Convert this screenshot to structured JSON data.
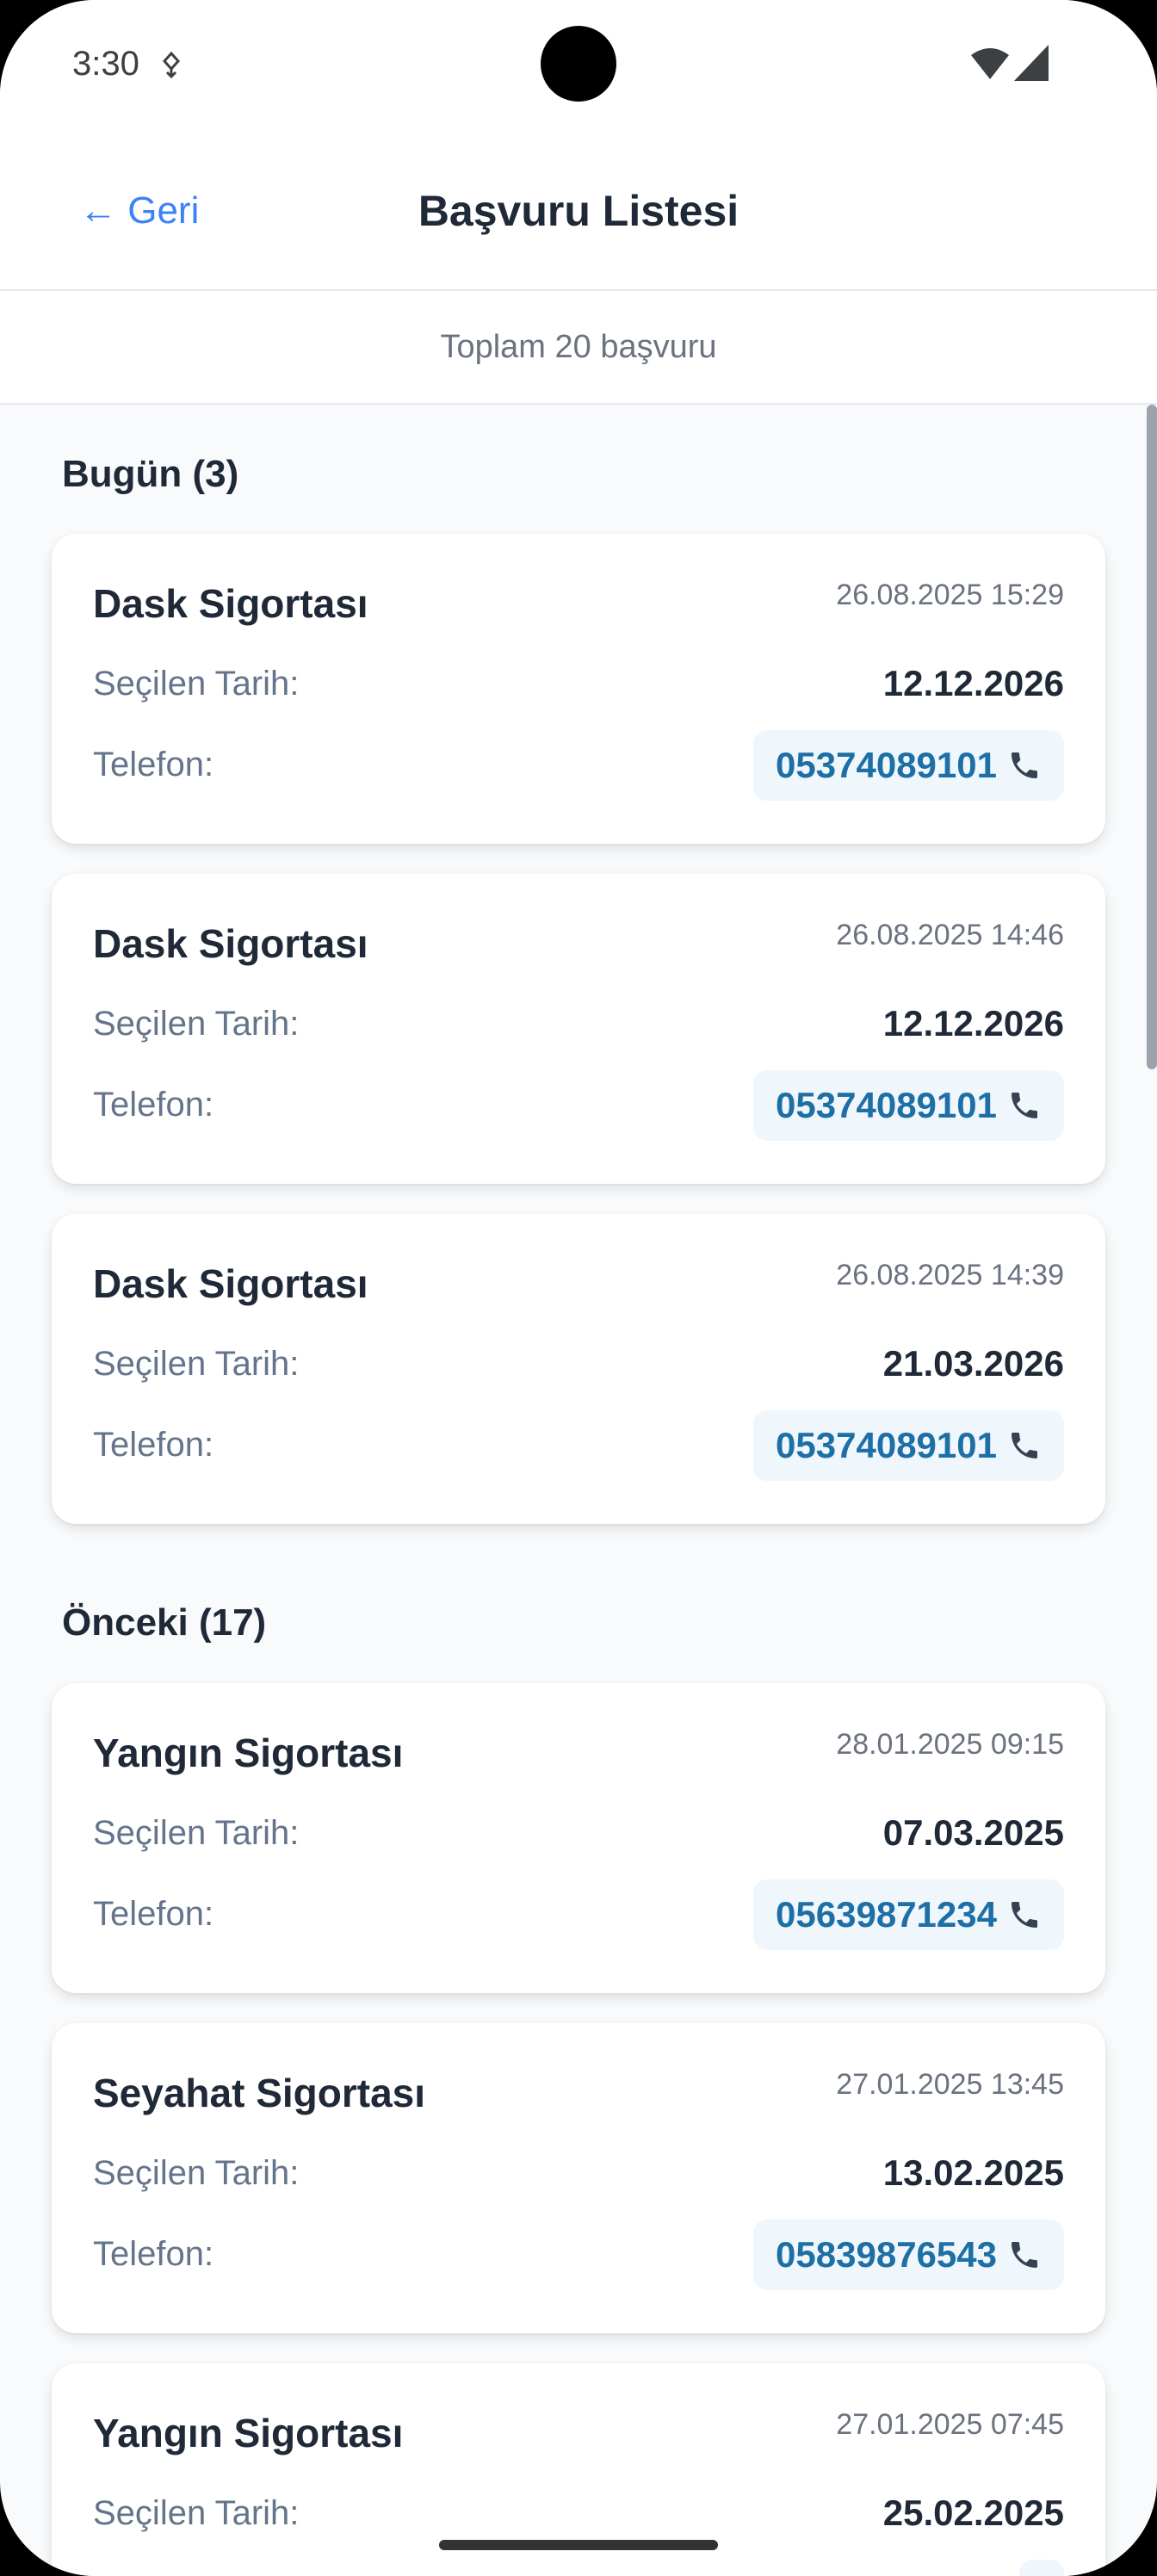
{
  "status_bar": {
    "time": "3:30"
  },
  "header": {
    "back_label": "← Geri",
    "title": "Başvuru Listesi"
  },
  "summary": {
    "text": "Toplam 20 başvuru"
  },
  "sections": [
    {
      "title": "Bugün (3)"
    },
    {
      "title": "Önceki (17)"
    }
  ],
  "labels": {
    "selected_date": "Seçilen Tarih:",
    "phone": "Telefon:"
  },
  "cards": [
    {
      "title": "Dask Sigortası",
      "created": "26.08.2025 15:29",
      "selected_date": "12.12.2026",
      "phone": "05374089101"
    },
    {
      "title": "Dask Sigortası",
      "created": "26.08.2025 14:46",
      "selected_date": "12.12.2026",
      "phone": "05374089101"
    },
    {
      "title": "Dask Sigortası",
      "created": "26.08.2025 14:39",
      "selected_date": "21.03.2026",
      "phone": "05374089101"
    },
    {
      "title": "Yangın Sigortası",
      "created": "28.01.2025 09:15",
      "selected_date": "07.03.2025",
      "phone": "05639871234"
    },
    {
      "title": "Seyahat Sigortası",
      "created": "27.01.2025 13:45",
      "selected_date": "13.02.2025",
      "phone": "05839876543"
    },
    {
      "title": "Yangın Sigortası",
      "created": "27.01.2025 07:45",
      "selected_date": "25.02.2025",
      "phone": ""
    }
  ],
  "colors": {
    "accent": "#3b82f6",
    "phone_text": "#1d6fa5",
    "phone_bg": "#eff6fc"
  }
}
